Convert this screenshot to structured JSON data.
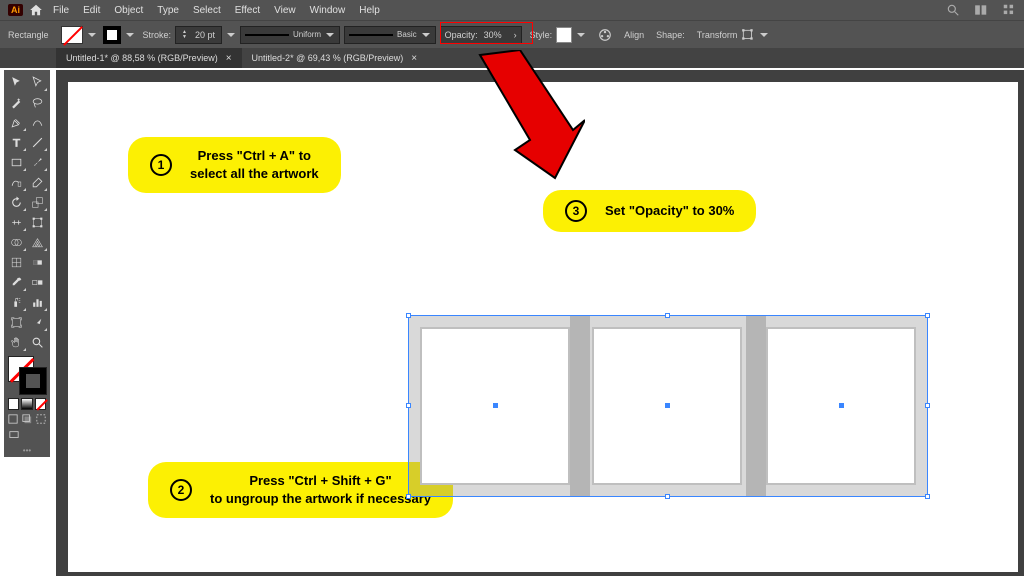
{
  "menubar": {
    "logo": "Ai",
    "items": [
      "File",
      "Edit",
      "Object",
      "Type",
      "Select",
      "Effect",
      "View",
      "Window",
      "Help"
    ]
  },
  "controlbar": {
    "shape": "Rectangle",
    "stroke_label": "Stroke:",
    "stroke_value": "20 pt",
    "profile1": "Uniform",
    "profile2": "Basic",
    "opacity_label": "Opacity:",
    "opacity_value": "30%",
    "style_label": "Style:",
    "align_label": "Align",
    "shape_btn_label": "Shape:",
    "transform_label": "Transform"
  },
  "tabs": [
    {
      "label": "Untitled-1* @ 88,58 % (RGB/Preview)",
      "active": true
    },
    {
      "label": "Untitled-2* @ 69,43 % (RGB/Preview)",
      "active": false
    }
  ],
  "callouts": {
    "c1": {
      "num": "1",
      "line1": "Press \"Ctrl + A\" to",
      "line2": "select all the artwork"
    },
    "c2": {
      "num": "2",
      "line1": "Press \"Ctrl + Shift + G\"",
      "line2": "to ungroup the artwork if necessary"
    },
    "c3": {
      "num": "3",
      "line1": "Set \"Opacity\" to 30%"
    }
  }
}
